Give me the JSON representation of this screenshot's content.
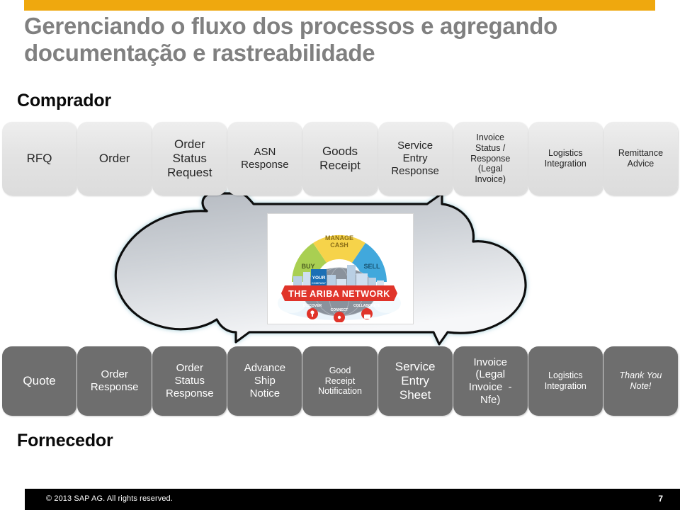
{
  "slide": {
    "title": "Gerenciando o fluxo dos processos e agregando documentação e rastreabilidade",
    "accent_color": "#efa80e",
    "title_color": "#808080"
  },
  "roles": {
    "buyer_label": "Comprador",
    "supplier_label": "Fornecedor"
  },
  "buyer_row": {
    "boxes": [
      {
        "label": "RFQ",
        "size": "fs-lg"
      },
      {
        "label": "Order",
        "size": "fs-lg"
      },
      {
        "label": "Order\nStatus\nRequest",
        "size": "fs-lg"
      },
      {
        "label": "ASN\nResponse",
        "size": "fs-md"
      },
      {
        "label": "Goods\nReceipt",
        "size": "fs-lg"
      },
      {
        "label": "Service\nEntry\nResponse",
        "size": "fs-md"
      },
      {
        "label": "Invoice\nStatus /\nResponse\n(Legal\nInvoice)",
        "size": "fs-sm"
      },
      {
        "label": "Logistics\nIntegration",
        "size": "fs-sm"
      },
      {
        "label": "Remittance\nAdvice",
        "size": "fs-sm"
      }
    ]
  },
  "supplier_row": {
    "boxes": [
      {
        "label": "Quote",
        "size": "fs-lg"
      },
      {
        "label": "Order\nResponse",
        "size": "fs-md"
      },
      {
        "label": "Order\nStatus\nResponse",
        "size": "fs-md"
      },
      {
        "label": "Advance\nShip\nNotice",
        "size": "fs-md"
      },
      {
        "label": "Good\nReceipt\nNotification",
        "size": "fs-sm"
      },
      {
        "label": "Service\nEntry\nSheet",
        "size": "fs-lg"
      },
      {
        "label": "Invoice\n(Legal\nInvoice  -\nNfe)",
        "size": "fs-md"
      },
      {
        "label": "Logistics\nIntegration",
        "size": "fs-sm"
      },
      {
        "label": "Thank You\nNote!",
        "size": "fs-sm italic"
      }
    ]
  },
  "network_graphic": {
    "name": "ariba-network-diagram",
    "banner": "THE ARIBA NETWORK",
    "segments": [
      "BUY",
      "MANAGE CASH",
      "SELL"
    ],
    "segment_colors": [
      "#a9cf52",
      "#f6d34a",
      "#41a8dc"
    ],
    "banner_color": "#e0342a",
    "bottom_labels": [
      "DISCOVER",
      "CONNECT",
      "COLLABORATE"
    ],
    "inset_label": "YOUR COMPANY"
  },
  "cloud": {
    "outline_color": "#111111",
    "glow_color": "#aed4dc",
    "fill_top": "#bcc0c6",
    "fill_bottom": "#f3f5f7"
  },
  "footer": {
    "copyright": "© 2013 SAP AG. All rights reserved.",
    "page_number": "7"
  }
}
